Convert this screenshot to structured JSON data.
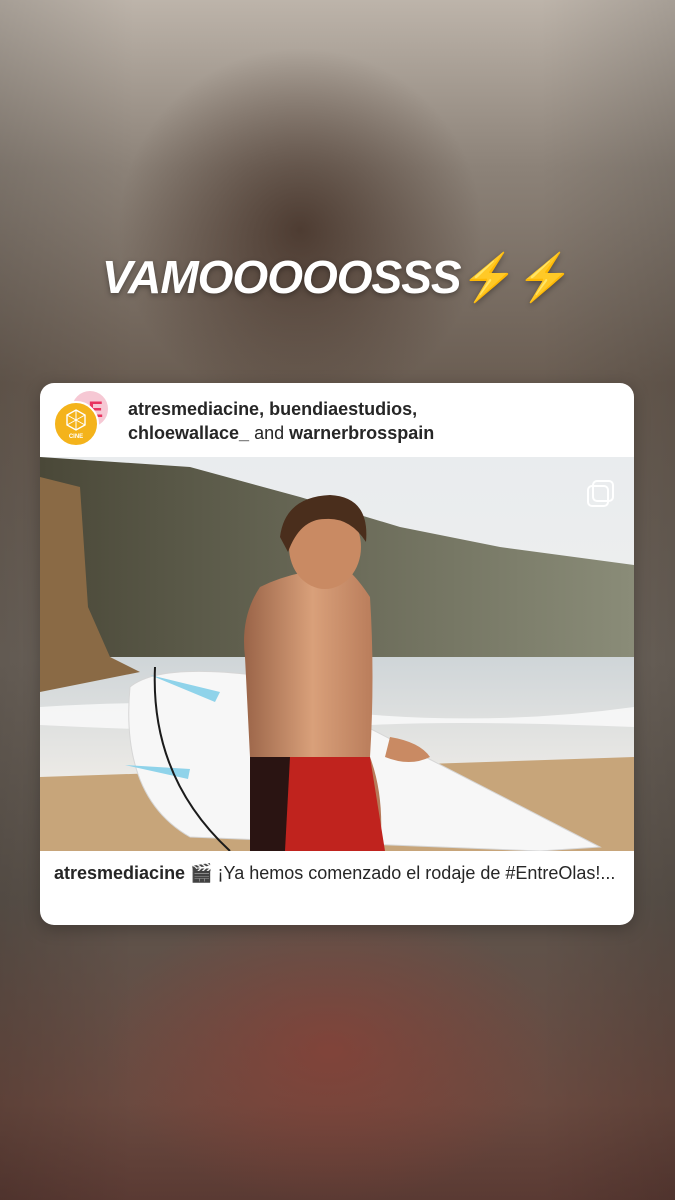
{
  "story": {
    "headline_text": "VAMOOOOOSSS",
    "headline_emoji": "⚡⚡"
  },
  "post": {
    "authors": {
      "first": "atresmediacine, buendiaestudios,",
      "second": "chloewallace_",
      "and_word": "and",
      "third": "warnerbrosspain"
    },
    "avatar_front_label": "CINE",
    "avatar_back_label": "E",
    "media_icon": "multiple-photos-icon",
    "caption": {
      "username": "atresmediacine",
      "emoji": "🎬",
      "text": "¡Ya hemos comenzado el rodaje de #EntreOlas!..."
    }
  },
  "colors": {
    "bolt": "#f5c518",
    "avatar_front": "#f4b31b",
    "avatar_back": "#f6c8d4",
    "text": "#262626"
  }
}
